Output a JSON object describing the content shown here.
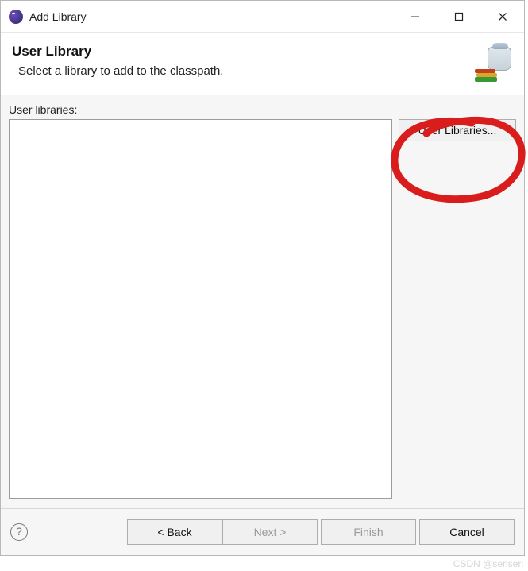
{
  "title": "Add Library",
  "header": {
    "title": "User Library",
    "description": "Select a library to add to the classpath."
  },
  "content": {
    "user_libraries_label": "User libraries:",
    "user_libraries_button": "User Libraries..."
  },
  "footer": {
    "back": "< Back",
    "next": "Next >",
    "finish": "Finish",
    "cancel": "Cancel"
  },
  "watermark": "CSDN @seriseri"
}
